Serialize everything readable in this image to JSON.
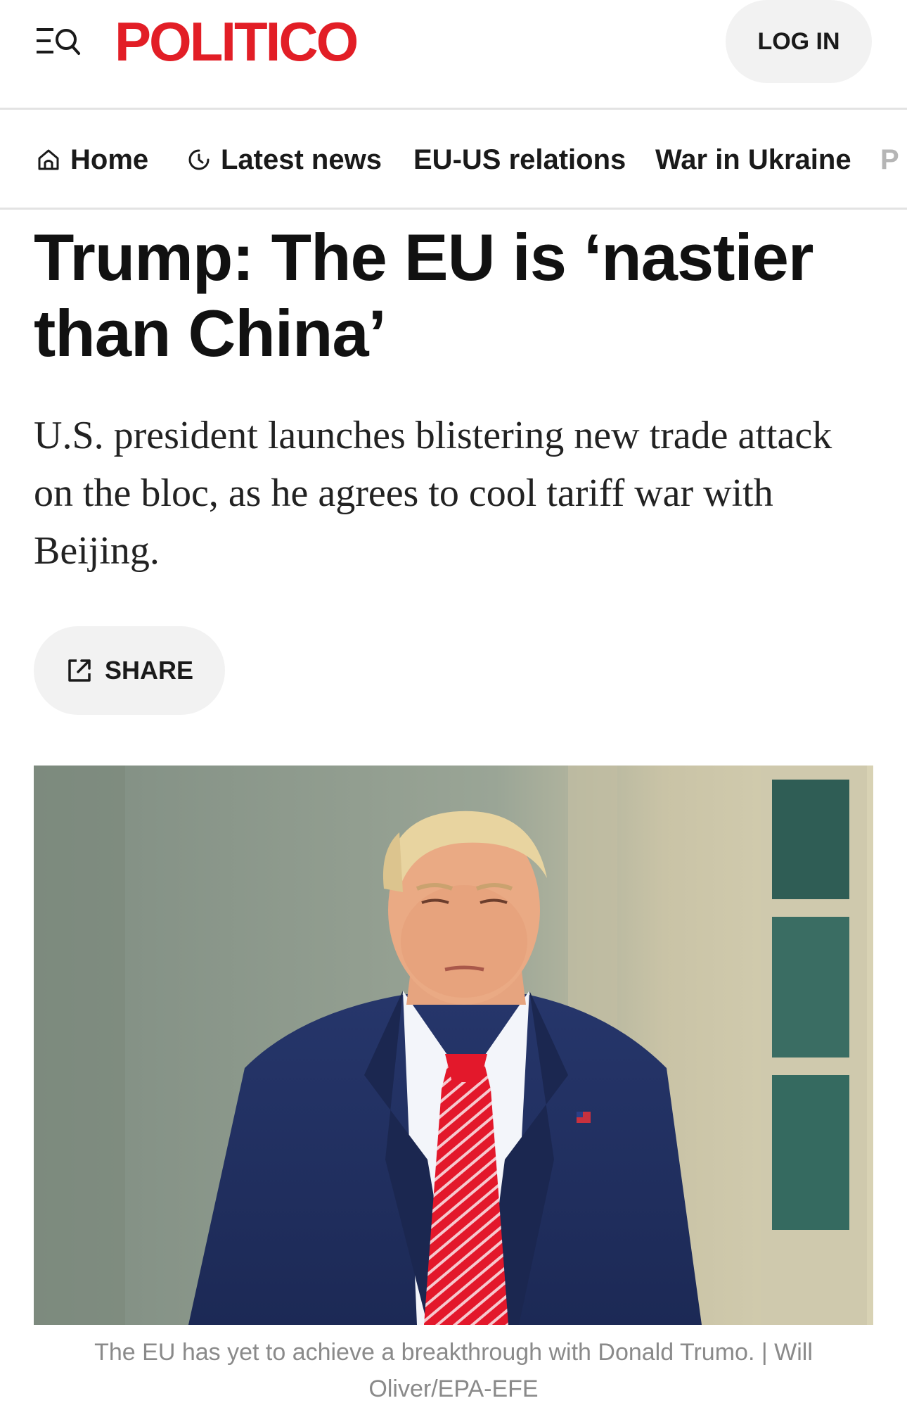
{
  "header": {
    "logo_text": "POLITICO",
    "login_label": "LOG IN",
    "menu_icon": "menu-search-icon"
  },
  "nav": {
    "items": [
      {
        "label": "Home",
        "icon": "home-icon"
      },
      {
        "label": "Latest news",
        "icon": "clock-icon"
      },
      {
        "label": "EU-US relations"
      },
      {
        "label": "War in Ukraine"
      },
      {
        "label": "P"
      }
    ]
  },
  "article": {
    "headline": "Trump: The EU is ‘nastier than China’",
    "dek": "U.S. president launches blistering new trade attack on the bloc, as he agrees to cool tariff war with Beijing.",
    "share_label": "SHARE",
    "caption": "The EU has yet to achieve a breakthrough with Donald Trumo. | Will Oliver/EPA-EFE"
  },
  "colors": {
    "brand_red": "#e21e26",
    "pill_bg": "#f2f2f2",
    "caption_gray": "#8a8a8a",
    "divider": "#e3e3e3"
  }
}
